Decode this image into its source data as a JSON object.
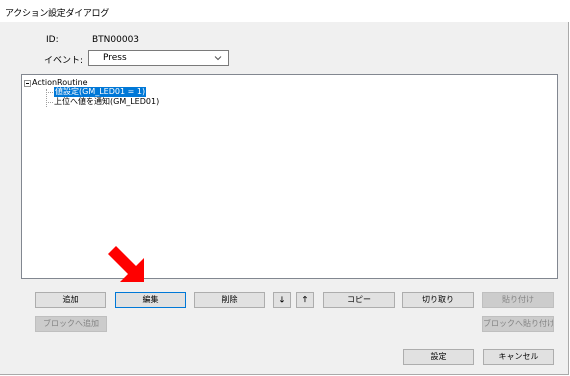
{
  "window": {
    "title": "アクション設定ダイアログ"
  },
  "fields": {
    "id_label": "ID:",
    "id_value": "BTN00003",
    "event_label": "イベント:",
    "event_value": "Press"
  },
  "tree": {
    "root_label": "ActionRoutine",
    "items": [
      {
        "label": "値設定(GM_LED01 = 1)",
        "selected": true
      },
      {
        "label": "上位へ値を通知(GM_LED01)",
        "selected": false
      }
    ]
  },
  "toolbar": {
    "add": "追加",
    "edit": "編集",
    "delete": "削除",
    "down": "🡓",
    "up": "🡑",
    "copy": "コピー",
    "cut": "切り取り",
    "paste": "貼り付け",
    "add_to_block": "ブロックへ追加",
    "paste_to_block": "ブロックへ貼り付け"
  },
  "footer": {
    "ok": "設定",
    "cancel": "キャンセル"
  },
  "colors": {
    "selection": "#0078d7",
    "annotation_arrow": "#ff0000",
    "dialog_bg": "#f0f0f0"
  },
  "icons": {
    "combo_arrow": "chevron-down-icon",
    "tree_expander": "minus-box-icon",
    "pointer": "red-arrow-icon"
  }
}
